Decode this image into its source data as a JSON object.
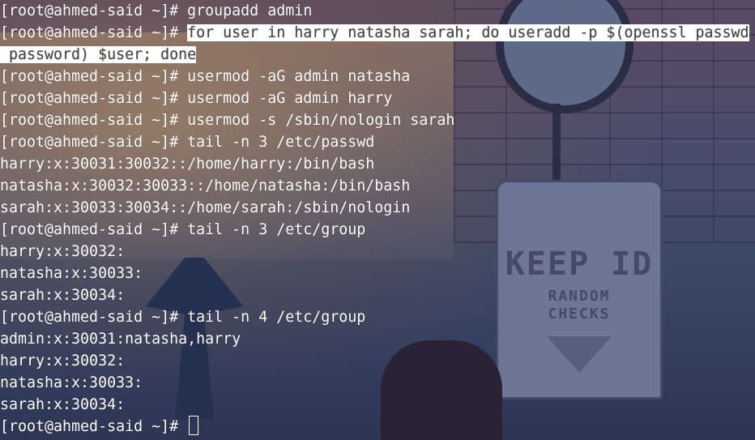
{
  "terminal": {
    "prompt": "[root@ahmed-said ~]# ",
    "wallpaper": {
      "sign_title": "KEEP ID",
      "sign_subtitle_line1": "RANDOM",
      "sign_subtitle_line2": "CHECKS"
    },
    "lines": [
      {
        "type": "command",
        "text": "groupadd admin"
      },
      {
        "type": "command-selected",
        "text": "for user in harry natasha sarah; do useradd -p $(openssl passwd"
      },
      {
        "type": "output-selected",
        "text": " password) $user; done"
      },
      {
        "type": "command",
        "text": "usermod -aG admin natasha"
      },
      {
        "type": "command",
        "text": "usermod -aG admin harry"
      },
      {
        "type": "command",
        "text": "usermod -s /sbin/nologin sarah"
      },
      {
        "type": "command",
        "text": "tail -n 3 /etc/passwd"
      },
      {
        "type": "output",
        "text": "harry:x:30031:30032::/home/harry:/bin/bash"
      },
      {
        "type": "output",
        "text": "natasha:x:30032:30033::/home/natasha:/bin/bash"
      },
      {
        "type": "output",
        "text": "sarah:x:30033:30034::/home/sarah:/sbin/nologin"
      },
      {
        "type": "command",
        "text": "tail -n 3 /etc/group"
      },
      {
        "type": "output",
        "text": "harry:x:30032:"
      },
      {
        "type": "output",
        "text": "natasha:x:30033:"
      },
      {
        "type": "output",
        "text": "sarah:x:30034:"
      },
      {
        "type": "command",
        "text": "tail -n 4 /etc/group"
      },
      {
        "type": "output",
        "text": "admin:x:30031:natasha,harry"
      },
      {
        "type": "output",
        "text": "harry:x:30032:"
      },
      {
        "type": "output",
        "text": "natasha:x:30033:"
      },
      {
        "type": "output",
        "text": "sarah:x:30034:"
      },
      {
        "type": "prompt-cursor",
        "text": ""
      }
    ]
  },
  "colors": {
    "text": "#ffffff",
    "selection_bg": "#ffffff",
    "selection_fg": "#404246"
  }
}
